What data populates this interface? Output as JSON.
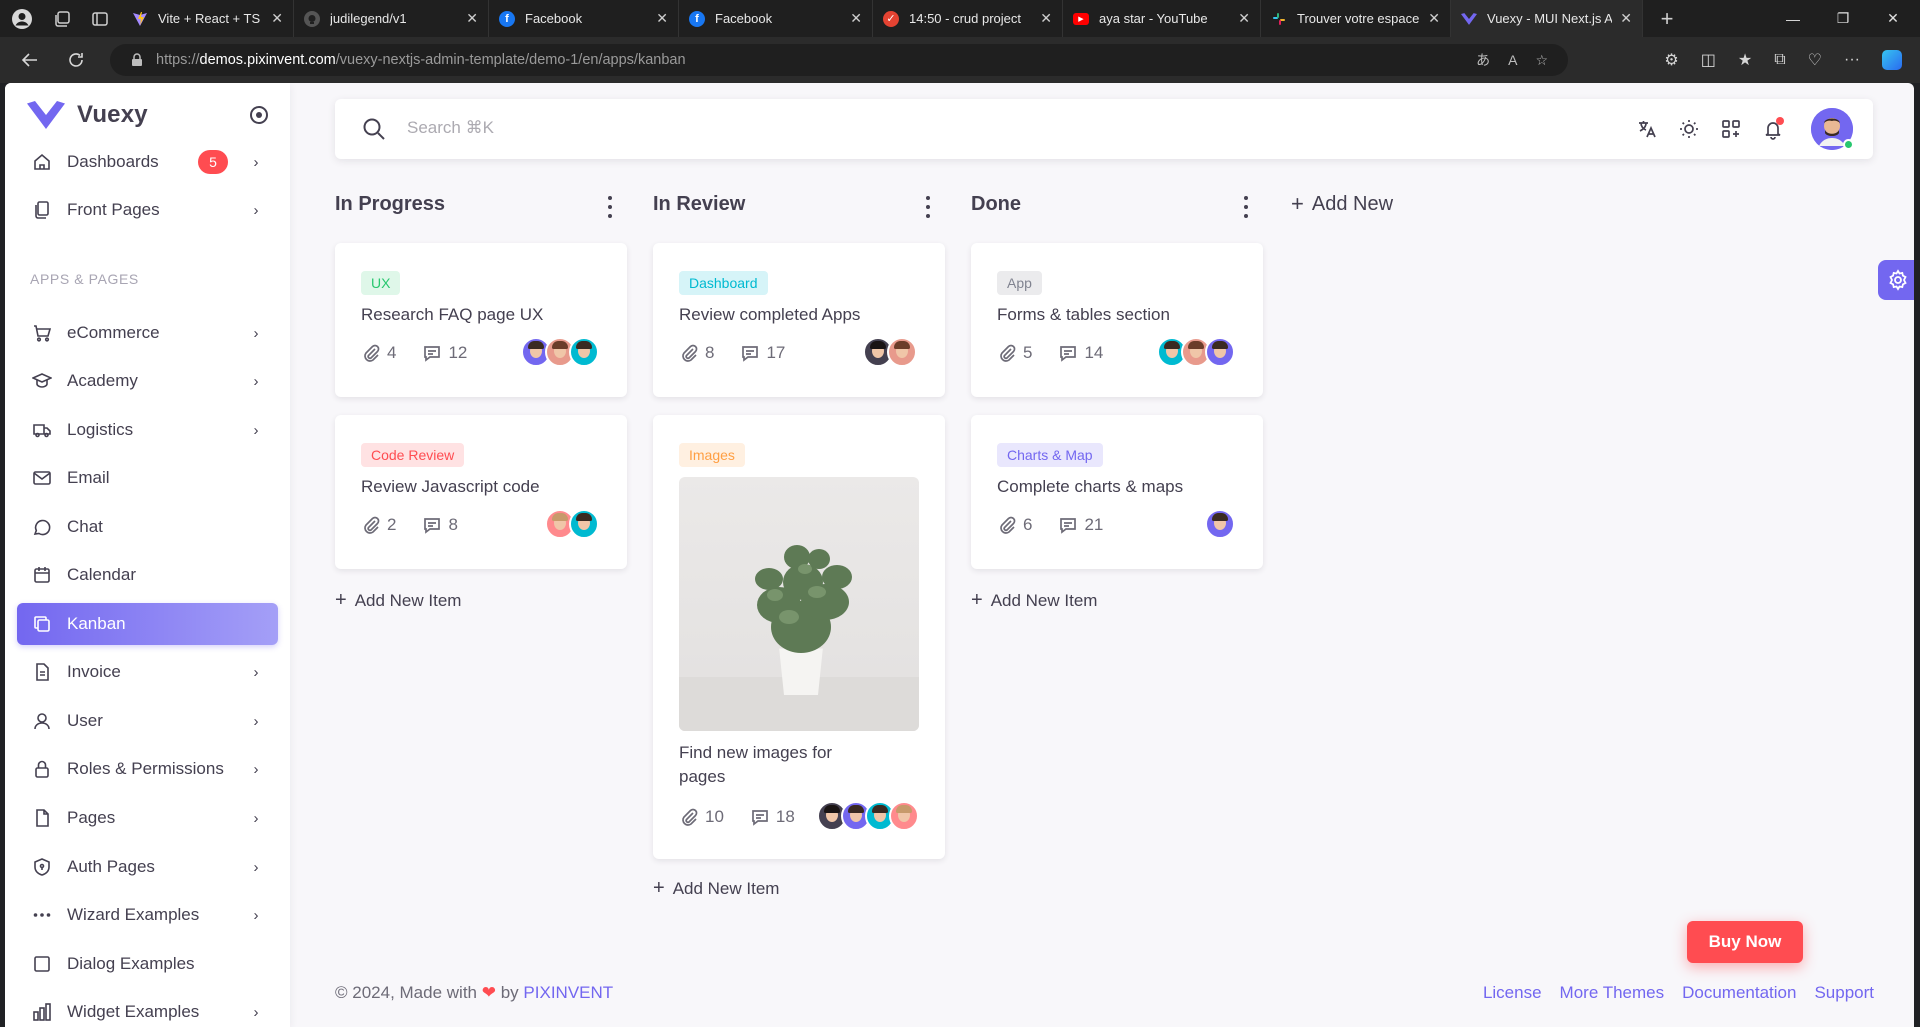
{
  "browser": {
    "tabs": [
      {
        "title": "Vite + React + TS",
        "favicon": "vite-favicon",
        "color": "#7f6cf7"
      },
      {
        "title": "judilegend/v1",
        "favicon": "github-favicon",
        "color": "#555555"
      },
      {
        "title": "Facebook",
        "favicon": "facebook-favicon",
        "color": "#1877f2"
      },
      {
        "title": "Facebook",
        "favicon": "facebook-favicon",
        "color": "#1877f2"
      },
      {
        "title": "14:50 - crud project",
        "favicon": "todo-favicon",
        "color": "#e44332"
      },
      {
        "title": "aya star - YouTube",
        "favicon": "youtube-favicon",
        "color": "#ff0000"
      },
      {
        "title": "Trouver votre espace",
        "favicon": "slack-favicon",
        "color": "#4a154b"
      },
      {
        "title": "Vuexy - MUI Next.js A",
        "favicon": "vuexy-favicon",
        "color": "#7367f0"
      }
    ],
    "url_prefix": "https://",
    "url_host": "demos.pixinvent.com",
    "url_path": "/vuexy-nextjs-admin-template/demo-1/en/apps/kanban"
  },
  "brand": {
    "name": "Vuexy"
  },
  "sidebar": {
    "section_header": "APPS & PAGES",
    "items": [
      {
        "label": "Dashboards",
        "icon": "smart-home-icon",
        "badge": "5"
      },
      {
        "label": "Front Pages",
        "icon": "files-icon"
      },
      {
        "label": "eCommerce",
        "icon": "shopping-cart-icon"
      },
      {
        "label": "Academy",
        "icon": "school-icon"
      },
      {
        "label": "Logistics",
        "icon": "truck-icon"
      },
      {
        "label": "Email",
        "icon": "mail-icon"
      },
      {
        "label": "Chat",
        "icon": "message-circle-icon"
      },
      {
        "label": "Calendar",
        "icon": "calendar-icon"
      },
      {
        "label": "Kanban",
        "icon": "copy-icon"
      },
      {
        "label": "Invoice",
        "icon": "file-description-icon"
      },
      {
        "label": "User",
        "icon": "user-icon"
      },
      {
        "label": "Roles & Permissions",
        "icon": "lock-icon"
      },
      {
        "label": "Pages",
        "icon": "file-icon"
      },
      {
        "label": "Auth Pages",
        "icon": "shield-lock-icon"
      },
      {
        "label": "Wizard Examples",
        "icon": "dots-icon"
      },
      {
        "label": "Dialog Examples",
        "icon": "square-icon"
      },
      {
        "label": "Widget Examples",
        "icon": "chart-bar-icon"
      }
    ]
  },
  "navbar": {
    "search_placeholder": "Search ⌘K"
  },
  "kanban": {
    "add_new_label": "Add New",
    "add_item_label": "Add New Item",
    "columns": [
      {
        "title": "In Progress",
        "cards": [
          {
            "chip": "UX",
            "chip_color": "#28c76f",
            "chip_bg": "#dff7e9",
            "title": "Research FAQ page UX",
            "attachments": "4",
            "comments": "12"
          },
          {
            "chip": "Code Review",
            "chip_color": "#ff4c51",
            "chip_bg": "#ffe2e3",
            "title": "Review Javascript code",
            "attachments": "2",
            "comments": "8"
          }
        ]
      },
      {
        "title": "In Review",
        "cards": [
          {
            "chip": "Dashboard",
            "chip_color": "#00bad1",
            "chip_bg": "#d6f4f8",
            "title": "Review completed Apps",
            "attachments": "8",
            "comments": "17"
          },
          {
            "chip": "Images",
            "chip_color": "#ff9f43",
            "chip_bg": "#fff0e1",
            "title_line1": "Find new images for",
            "title_line2": "pages",
            "attachments": "10",
            "comments": "18"
          }
        ]
      },
      {
        "title": "Done",
        "cards": [
          {
            "chip": "App",
            "chip_color": "#808390",
            "chip_bg": "#ebebed",
            "title": "Forms & tables section",
            "attachments": "5",
            "comments": "14"
          },
          {
            "chip": "Charts & Map",
            "chip_color": "#7367f0",
            "chip_bg": "#e9e7fd",
            "title": "Complete charts & maps",
            "attachments": "6",
            "comments": "21"
          }
        ]
      }
    ]
  },
  "footer": {
    "copyright": "© 2024, Made with",
    "by": "by",
    "company": "PIXINVENT",
    "links": [
      "License",
      "More Themes",
      "Documentation",
      "Support"
    ]
  },
  "buy_now": "Buy Now",
  "colors": {
    "primary": "#7367f0",
    "danger": "#ff4c51",
    "success": "#28c76f",
    "background": "#f8f7fa"
  }
}
